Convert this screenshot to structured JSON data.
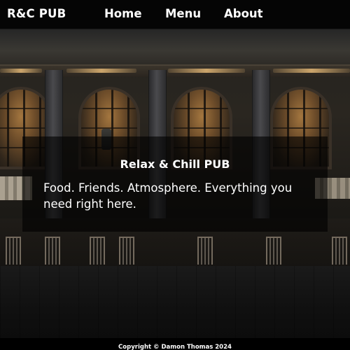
{
  "brand": {
    "name": "R&C PUB"
  },
  "nav": {
    "items": [
      {
        "label": "Home"
      },
      {
        "label": "Menu"
      },
      {
        "label": "About"
      }
    ]
  },
  "hero": {
    "title": "Relax & Chill PUB",
    "text": "Food. Friends. Atmosphere. Everything you need right here.",
    "overlay_color": "#000000"
  },
  "footer": {
    "copyright": "Copyright © Damon Thomas 2024"
  },
  "colors": {
    "navbar_bg": "#050505",
    "text": "#ffffff",
    "warm_light": "#ffcd82"
  }
}
